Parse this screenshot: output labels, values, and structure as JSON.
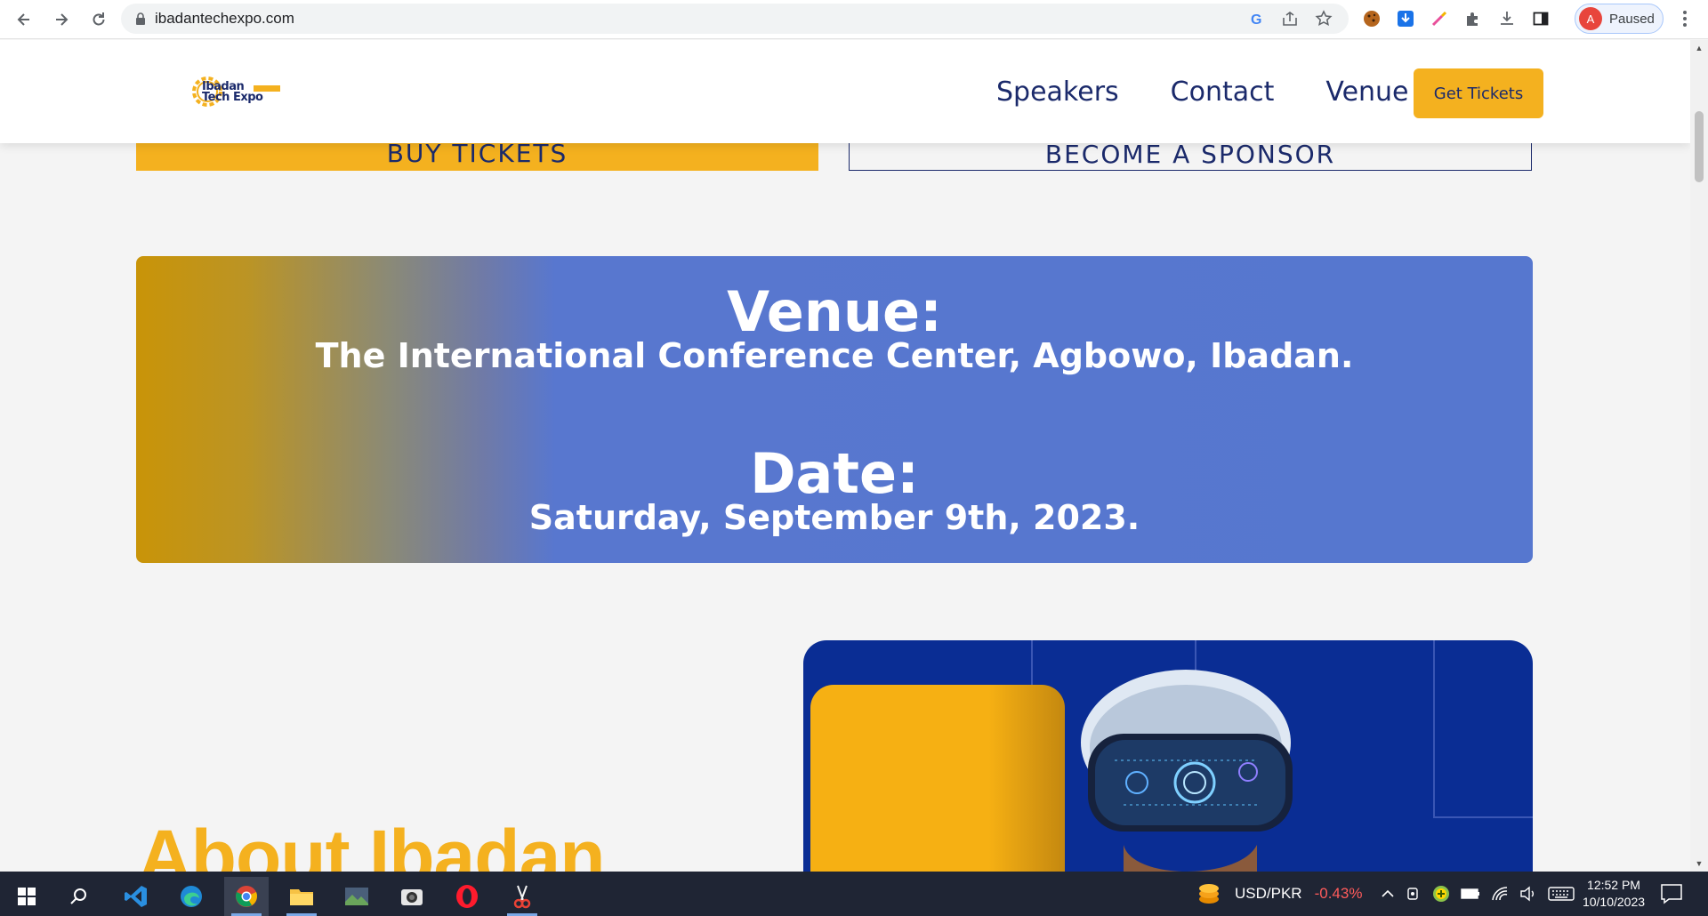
{
  "browser": {
    "url": "ibadantechexpo.com",
    "profile_initial": "A",
    "profile_status": "Paused"
  },
  "site": {
    "logo_line1": "Ibadan",
    "logo_line2": "Tech Expo",
    "nav": [
      "Speakers",
      "Contact",
      "Venue"
    ],
    "cta_button": "Get Tickets",
    "buy_tickets": "BUY TICKETS",
    "become_sponsor": "BECOME A SPONSOR",
    "colors": {
      "brand_navy": "#1b2a6b",
      "brand_yellow": "#f4b11f",
      "banner_blue": "#5677cf"
    }
  },
  "banner": {
    "venue_heading": "Venue:",
    "venue_text": "The International Conference Center, Agbowo, Ibadan.",
    "date_heading": "Date:",
    "date_text": "Saturday, September 9th, 2023."
  },
  "about": {
    "title": "About Ibadan"
  },
  "taskbar": {
    "ticker_label": "USD/PKR",
    "ticker_change": "-0.43%",
    "time": "12:52 PM",
    "date": "10/10/2023",
    "apps": [
      "start-icon",
      "search-icon",
      "vscode-icon",
      "edge-icon",
      "chrome-icon",
      "file-explorer-icon",
      "photos-icon",
      "camera-icon",
      "opera-icon",
      "snipping-tool-icon"
    ]
  }
}
